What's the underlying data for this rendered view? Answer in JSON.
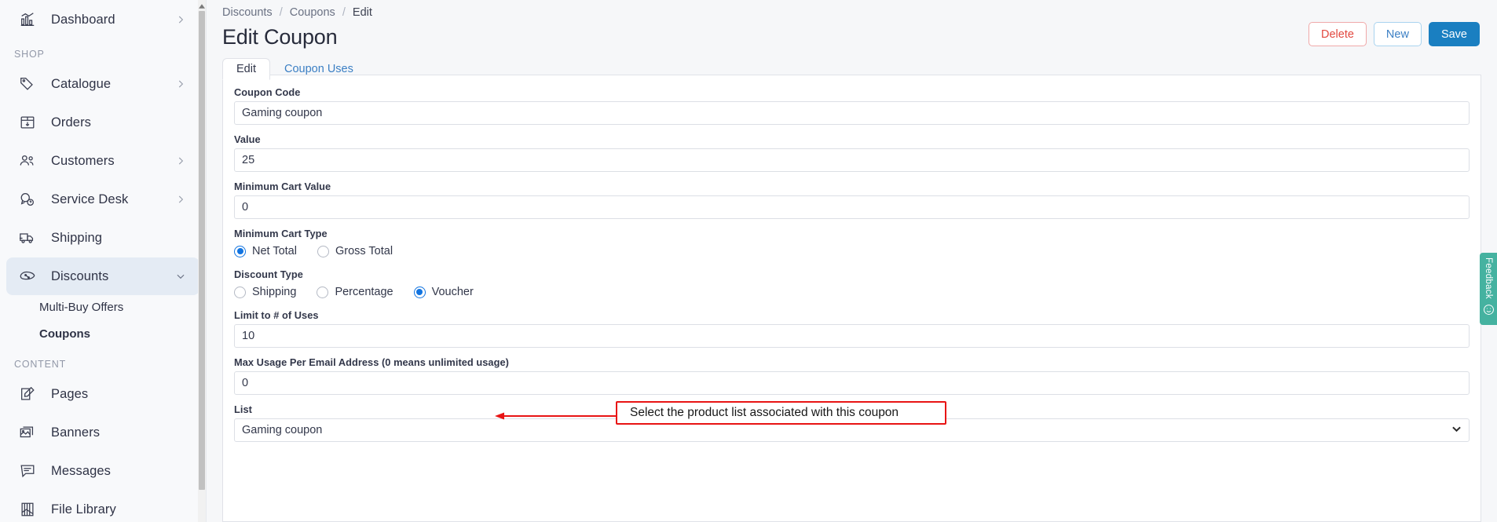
{
  "sidebar": {
    "items": [
      {
        "label": "Dashboard",
        "icon": "dashboard-chart-icon",
        "chevron": "chevron-right",
        "active": false
      },
      {
        "label": "Catalogue",
        "icon": "tags-icon",
        "chevron": "chevron-right",
        "active": false
      },
      {
        "label": "Orders",
        "icon": "box-download-icon",
        "chevron": "",
        "active": false
      },
      {
        "label": "Customers",
        "icon": "users-icon",
        "chevron": "chevron-right",
        "active": false
      },
      {
        "label": "Service Desk",
        "icon": "question-bubble-icon",
        "chevron": "chevron-right",
        "active": false
      },
      {
        "label": "Shipping",
        "icon": "truck-icon",
        "chevron": "",
        "active": false
      },
      {
        "label": "Discounts",
        "icon": "percent-tag-icon",
        "chevron": "chevron-down",
        "active": true
      },
      {
        "label": "Pages",
        "icon": "page-edit-icon",
        "chevron": "",
        "active": false
      },
      {
        "label": "Banners",
        "icon": "images-icon",
        "chevron": "",
        "active": false
      },
      {
        "label": "Messages",
        "icon": "message-icon",
        "chevron": "",
        "active": false
      },
      {
        "label": "File Library",
        "icon": "file-library-icon",
        "chevron": "",
        "active": false
      }
    ],
    "section_shop": "SHOP",
    "section_content": "CONTENT",
    "sub_items": [
      {
        "label": "Multi-Buy Offers",
        "current": false
      },
      {
        "label": "Coupons",
        "current": true
      }
    ]
  },
  "header": {
    "breadcrumb": [
      "Discounts",
      "Coupons",
      "Edit"
    ],
    "separator": "/",
    "title": "Edit Coupon",
    "buttons": {
      "delete": "Delete",
      "new": "New",
      "save": "Save"
    }
  },
  "tabs": [
    {
      "label": "Edit",
      "active": true
    },
    {
      "label": "Coupon Uses",
      "active": false
    }
  ],
  "form": {
    "coupon_code": {
      "label": "Coupon Code",
      "value": "Gaming coupon"
    },
    "value": {
      "label": "Value",
      "value": "25"
    },
    "minimum_cart_value": {
      "label": "Minimum Cart Value",
      "value": "0"
    },
    "minimum_cart_type": {
      "label": "Minimum Cart Type",
      "options": [
        {
          "label": "Net Total",
          "checked": true
        },
        {
          "label": "Gross Total",
          "checked": false
        }
      ]
    },
    "discount_type": {
      "label": "Discount Type",
      "options": [
        {
          "label": "Shipping",
          "checked": false
        },
        {
          "label": "Percentage",
          "checked": false
        },
        {
          "label": "Voucher",
          "checked": true
        }
      ]
    },
    "limit_uses": {
      "label": "Limit to # of Uses",
      "value": "10"
    },
    "max_usage_email": {
      "label": "Max Usage Per Email Address (0 means unlimited usage)",
      "value": "0"
    },
    "list": {
      "label": "List",
      "value": "Gaming coupon"
    }
  },
  "annotation": {
    "text": "Select the product list associated with this coupon",
    "color": "#e81414"
  },
  "feedback": {
    "label": "Feedback",
    "icon": "smiley-face-icon",
    "color": "#45b2a0"
  },
  "colors": {
    "accent": "#1a7fc1",
    "radio_blue": "#1274e0",
    "danger": "#e2483f",
    "sidebar_bg": "#f8f9fb",
    "main_bg": "#f6f7f9"
  }
}
